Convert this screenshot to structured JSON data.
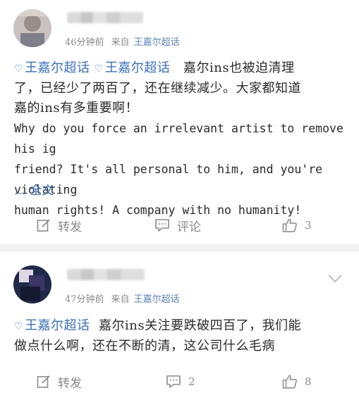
{
  "posts": [
    {
      "time": "46分钟前",
      "from_label": "来自",
      "source": "王嘉尔超话",
      "tags": [
        "王嘉尔超话",
        "王嘉尔超话"
      ],
      "text_cn_1": "嘉尔ins也被迫清理",
      "text_cn_2": "了，已经少了两百了，还在继续减少。大家都知道",
      "text_cn_3": "嘉的ins有多重要啊！",
      "text_en_1": "Why do you force an irrelevant artist to remove his ig",
      "text_en_2": "friend? It's all personal to him, and you're violating",
      "text_en_3": "human rights! A company with no humanity!",
      "more": "… 全文",
      "repost_label": "转发",
      "comment_label": "评论",
      "like_count": "3"
    },
    {
      "time": "47分钟前",
      "from_label": "来自",
      "source": "王嘉尔超话",
      "tags": [
        "王嘉尔超话"
      ],
      "text_line_1": "嘉尔ins关注要跌破四百了，我们能",
      "text_line_2": "做点什么啊，还在不断的清，这公司什么毛病",
      "repost_label": "转发",
      "comment_count": "2",
      "like_count": "8"
    }
  ],
  "share_badge": {
    "count": "3",
    "icon": "thumbs-up-icon"
  },
  "colors": {
    "link": "#3a6fb9",
    "meta": "#8a8a8a",
    "text": "#2a2a2a",
    "badge": "#6e6e6e"
  }
}
